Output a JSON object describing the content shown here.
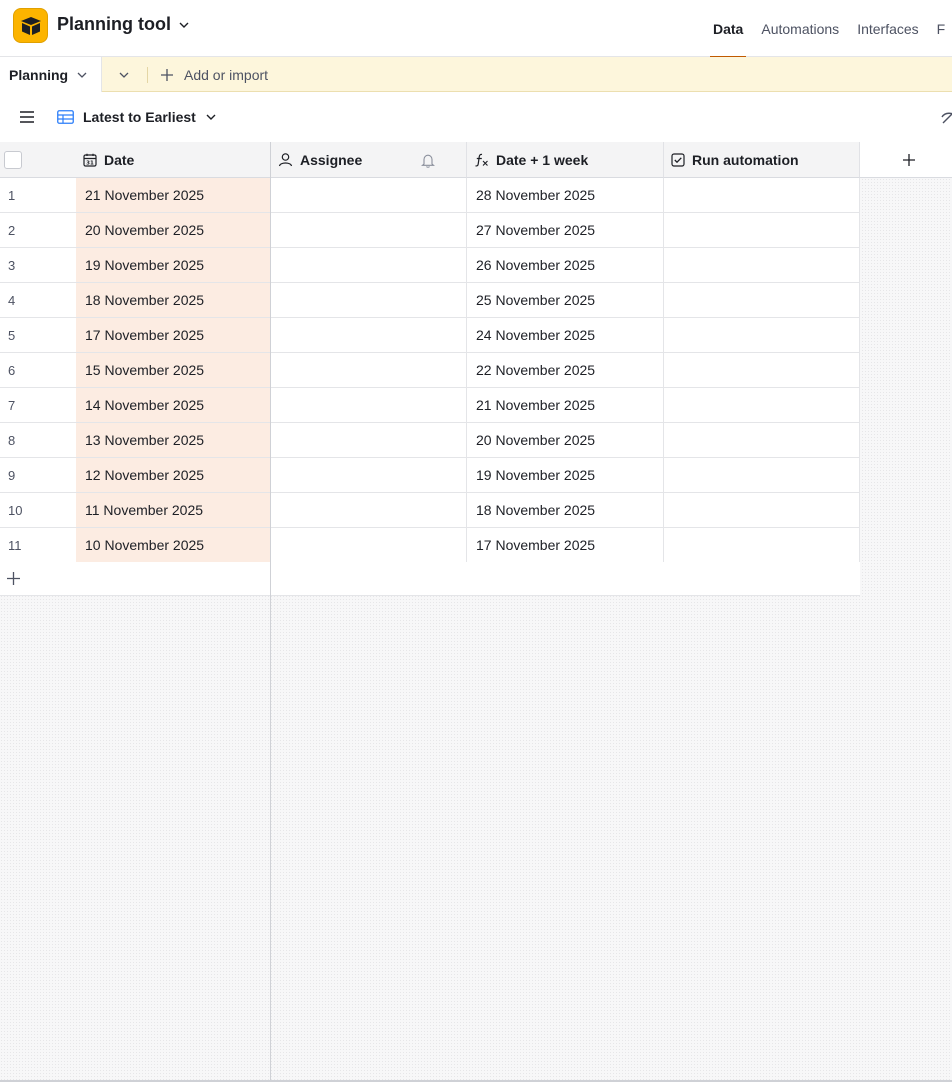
{
  "header": {
    "base_title": "Planning tool",
    "nav": [
      "Data",
      "Automations",
      "Interfaces",
      "F"
    ],
    "accent_color": "#c05a00",
    "logo_color": "#fcb400"
  },
  "tabbar": {
    "table_name": "Planning",
    "add_or_import": "Add or import"
  },
  "viewbar": {
    "view_name": "Latest to Earliest"
  },
  "columns": {
    "date": "Date",
    "assignee": "Assignee",
    "date_plus": "Date + 1 week",
    "run": "Run automation"
  },
  "rows": [
    {
      "num": "1",
      "date": "21 November 2025",
      "plus": "28 November 2025"
    },
    {
      "num": "2",
      "date": "20 November 2025",
      "plus": "27 November 2025"
    },
    {
      "num": "3",
      "date": "19 November 2025",
      "plus": "26 November 2025"
    },
    {
      "num": "4",
      "date": "18 November 2025",
      "plus": "25 November 2025"
    },
    {
      "num": "5",
      "date": "17 November 2025",
      "plus": "24 November 2025"
    },
    {
      "num": "6",
      "date": "15 November 2025",
      "plus": "22 November 2025"
    },
    {
      "num": "7",
      "date": "14 November 2025",
      "plus": "21 November 2025"
    },
    {
      "num": "8",
      "date": "13 November 2025",
      "plus": "20 November 2025"
    },
    {
      "num": "9",
      "date": "12 November 2025",
      "plus": "19 November 2025"
    },
    {
      "num": "10",
      "date": "11 November 2025",
      "plus": "18 November 2025"
    },
    {
      "num": "11",
      "date": "10 November 2025",
      "plus": "17 November 2025"
    }
  ]
}
